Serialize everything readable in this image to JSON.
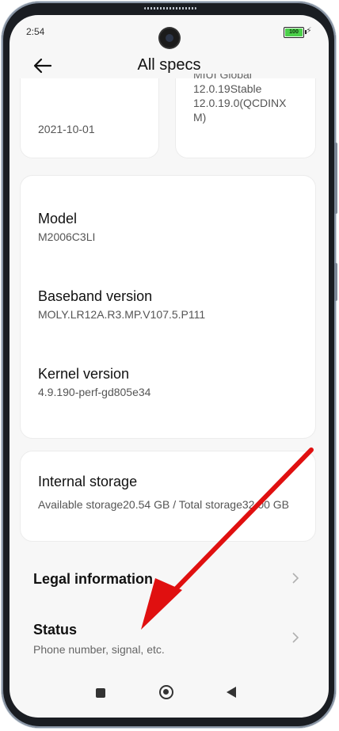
{
  "status_bar": {
    "time": "2:54",
    "battery_level": "100"
  },
  "header": {
    "title": "All specs"
  },
  "top_cards": {
    "left": {
      "value": "2021-10-01"
    },
    "right": {
      "value_lines": [
        "MIUI Global",
        "12.0.19Stable",
        "12.0.19.0(QCDINX",
        "M)"
      ]
    }
  },
  "specs": [
    {
      "title": "Model",
      "value": "M2006C3LI"
    },
    {
      "title": "Baseband version",
      "value": "MOLY.LR12A.R3.MP.V107.5.P111"
    },
    {
      "title": "Kernel version",
      "value": "4.9.190-perf-gd805e34"
    }
  ],
  "storage": {
    "title": "Internal storage",
    "value": "Available storage20.54 GB / Total storage32.00 GB"
  },
  "menu": [
    {
      "title": "Legal information",
      "subtitle": ""
    },
    {
      "title": "Status",
      "subtitle": "Phone number, signal, etc."
    }
  ],
  "colors": {
    "annotation_arrow": "#e01010",
    "battery": "#4cd04a"
  },
  "icons": {
    "back": "back-arrow-icon",
    "chevron": "chevron-right-icon",
    "nav_recents": "square-icon",
    "nav_home": "circle-icon",
    "nav_back": "triangle-back-icon"
  }
}
